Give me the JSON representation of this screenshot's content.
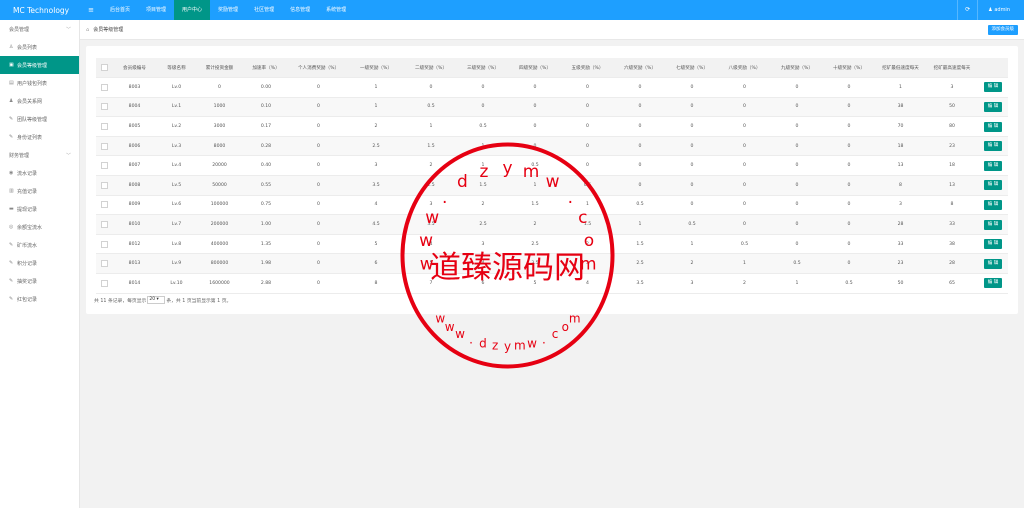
{
  "app": {
    "title": "MC Technology"
  },
  "topnav": {
    "menu_glyph": "≡",
    "items": [
      "后台首页",
      "项目管理",
      "用户中心",
      "奖励管理",
      "社区管理",
      "信息管理",
      "系统管理"
    ],
    "active_index": 2,
    "refresh_glyph": "⟳",
    "user_glyph": "♟",
    "user": "admin"
  },
  "sidebar": {
    "group1": "会员管理",
    "group1_items": [
      {
        "icon": "user-icon",
        "glyph": "♙",
        "label": "会员列表"
      },
      {
        "icon": "grade-icon",
        "glyph": "▣",
        "label": "会员等级管理",
        "active": true
      },
      {
        "icon": "wallet-icon",
        "glyph": "▤",
        "label": "用户钱包列表"
      },
      {
        "icon": "users-icon",
        "glyph": "♟",
        "label": "会员关系网"
      },
      {
        "icon": "link-icon",
        "glyph": "✎",
        "label": "团队等级管理"
      },
      {
        "icon": "link-icon",
        "glyph": "✎",
        "label": "身份证列表"
      }
    ],
    "group2": "财务管理",
    "group2_items": [
      {
        "icon": "flow-icon",
        "glyph": "◉",
        "label": "流水记录"
      },
      {
        "icon": "recharge-icon",
        "glyph": "▥",
        "label": "充值记录"
      },
      {
        "icon": "withdraw-icon",
        "glyph": "▬",
        "label": "提现记录"
      },
      {
        "icon": "coin-icon",
        "glyph": "◎",
        "label": "余额宝流水"
      },
      {
        "icon": "link-icon",
        "glyph": "✎",
        "label": "矿币流水"
      },
      {
        "icon": "link-icon",
        "glyph": "✎",
        "label": "积分记录"
      },
      {
        "icon": "link-icon",
        "glyph": "✎",
        "label": "抽奖记录"
      },
      {
        "icon": "link-icon",
        "glyph": "✎",
        "label": "红包记录"
      }
    ]
  },
  "breadcrumb": {
    "text": "会员等级管理",
    "add_button": "添加会员级"
  },
  "table": {
    "headers": [
      "会员级编号",
      "等级名称",
      "累计投资金额",
      "加速率（%）",
      "个人消费奖励（%）",
      "一级奖励（%）",
      "二级奖励（%）",
      "三级奖励（%）",
      "四级奖励（%）",
      "五级奖励（%）",
      "六级奖励（%）",
      "七级奖励（%）",
      "八级奖励（%）",
      "九级奖励（%）",
      "十级奖励（%）",
      "挖矿最低速度每天",
      "挖矿最高速度每天"
    ],
    "rows": [
      [
        "8003",
        "Lv.0",
        "0",
        "0.00",
        "0",
        "1",
        "0",
        "0",
        "0",
        "0",
        "0",
        "0",
        "0",
        "0",
        "0",
        "1",
        "3"
      ],
      [
        "8004",
        "Lv.1",
        "1000",
        "0.10",
        "0",
        "1",
        "0.5",
        "0",
        "0",
        "0",
        "0",
        "0",
        "0",
        "0",
        "0",
        "38",
        "50"
      ],
      [
        "8005",
        "Lv.2",
        "3000",
        "0.17",
        "0",
        "2",
        "1",
        "0.5",
        "0",
        "0",
        "0",
        "0",
        "0",
        "0",
        "0",
        "70",
        "80"
      ],
      [
        "8006",
        "Lv.3",
        "8000",
        "0.28",
        "0",
        "2.5",
        "1.5",
        "1",
        "0",
        "0",
        "0",
        "0",
        "0",
        "0",
        "0",
        "18",
        "23"
      ],
      [
        "8007",
        "Lv.4",
        "20000",
        "0.40",
        "0",
        "3",
        "2",
        "1",
        "0.5",
        "0",
        "0",
        "0",
        "0",
        "0",
        "0",
        "13",
        "18"
      ],
      [
        "8008",
        "Lv.5",
        "50000",
        "0.55",
        "0",
        "3.5",
        "2.5",
        "1.5",
        "1",
        "0.5",
        "0",
        "0",
        "0",
        "0",
        "0",
        "8",
        "13"
      ],
      [
        "8009",
        "Lv.6",
        "100000",
        "0.75",
        "0",
        "4",
        "3",
        "2",
        "1.5",
        "1",
        "0.5",
        "0",
        "0",
        "0",
        "0",
        "3",
        "8"
      ],
      [
        "8010",
        "Lv.7",
        "200000",
        "1.00",
        "0",
        "4.5",
        "3.5",
        "2.5",
        "2",
        "1.5",
        "1",
        "0.5",
        "0",
        "0",
        "0",
        "28",
        "33"
      ],
      [
        "8012",
        "Lv.8",
        "400000",
        "1.35",
        "0",
        "5",
        "4",
        "3",
        "2.5",
        "2",
        "1.5",
        "1",
        "0.5",
        "0",
        "0",
        "33",
        "38"
      ],
      [
        "8013",
        "Lv.9",
        "800000",
        "1.98",
        "0",
        "6",
        "5",
        "4",
        "3.5",
        "3",
        "2.5",
        "2",
        "1",
        "0.5",
        "0",
        "23",
        "28"
      ],
      [
        "8014",
        "Lv.10",
        "1600000",
        "2.88",
        "0",
        "8",
        "7",
        "6",
        "5",
        "4",
        "3.5",
        "3",
        "2",
        "1",
        "0.5",
        "50",
        "65"
      ]
    ],
    "edit_label": "编 辑"
  },
  "pagination": {
    "prefix": "共 11 条记录，每页显示",
    "page_size": "20",
    "suffix": "条，共 1 页当前显示第 1 页。"
  },
  "watermark": {
    "center": "道臻源码网",
    "top_arc": [
      "w",
      "w",
      "w",
      ".",
      "d",
      "z",
      "y",
      "m",
      "w",
      ".",
      "c",
      "o",
      "m"
    ],
    "bottom_arc": [
      "w",
      "w",
      "w",
      ".",
      "d",
      "z",
      "y",
      "m",
      "w",
      ".",
      "c",
      "o",
      "m"
    ]
  },
  "colors": {
    "topbar": "#1e9fff",
    "accent": "#009688",
    "watermark": "#e60012"
  }
}
